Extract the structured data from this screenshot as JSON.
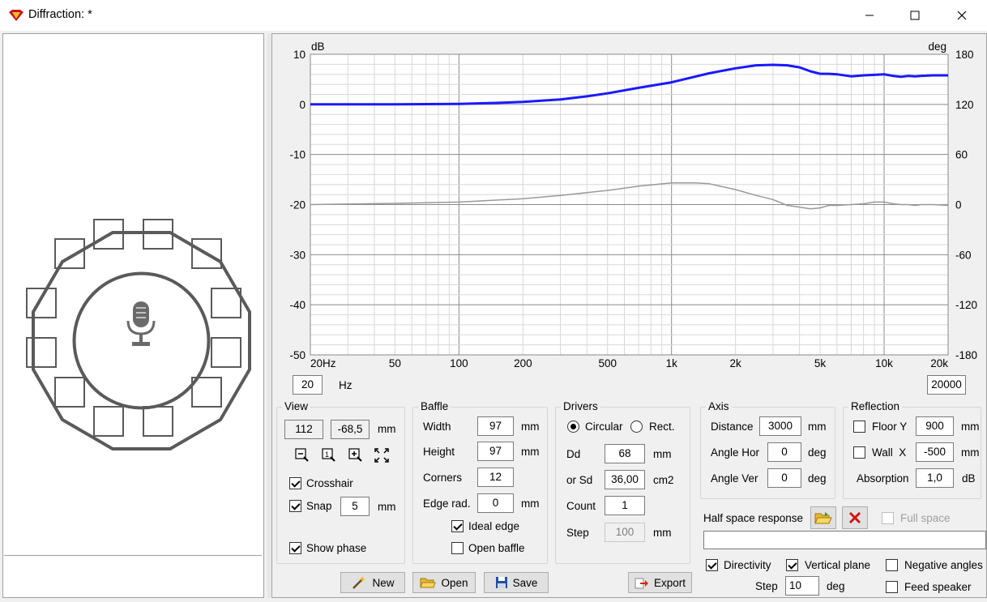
{
  "window": {
    "title": "Diffraction: *"
  },
  "chart_data": {
    "type": "line",
    "xscale": "log",
    "xlim": [
      20,
      20000
    ],
    "ylim": [
      -50,
      10
    ],
    "y2lim": [
      -180,
      180
    ],
    "ylabel": "dB",
    "y2label": "deg",
    "x_ticks": [
      "20Hz",
      "50",
      "100",
      "200",
      "500",
      "1k",
      "2k",
      "5k",
      "10k",
      "20k"
    ],
    "y_ticks": [
      "10",
      "0",
      "-10",
      "-20",
      "-30",
      "-40",
      "-50"
    ],
    "y2_ticks": [
      "180",
      "120",
      "60",
      "0",
      "-60",
      "-120",
      "-180"
    ],
    "grid": true,
    "series": [
      {
        "axis": "left",
        "color": "#1a1aff",
        "x": [
          20,
          50,
          100,
          150,
          200,
          300,
          400,
          500,
          700,
          1000,
          1500,
          2000,
          2500,
          3000,
          3500,
          4000,
          4500,
          5000,
          5500,
          6000,
          7000,
          8000,
          9000,
          10000,
          11000,
          12000,
          13000,
          14000,
          15000,
          17000,
          20000
        ],
        "y": [
          0,
          0,
          0.1,
          0.3,
          0.5,
          1.0,
          1.6,
          2.2,
          3.3,
          4.4,
          6.2,
          7.2,
          7.8,
          7.9,
          7.8,
          7.4,
          6.6,
          6.1,
          6.1,
          6.0,
          5.6,
          5.8,
          5.9,
          6.0,
          5.7,
          5.5,
          5.7,
          5.6,
          5.7,
          5.8,
          5.8
        ]
      },
      {
        "axis": "right",
        "color": "#999999",
        "x": [
          20,
          50,
          100,
          200,
          300,
          500,
          700,
          1000,
          1300,
          1500,
          2000,
          2500,
          3000,
          3500,
          4000,
          4500,
          5000,
          5500,
          6000,
          7000,
          8000,
          9000,
          10000,
          11000,
          12000,
          13000,
          14000,
          15000,
          17000,
          20000
        ],
        "y": [
          0,
          1.5,
          3,
          7,
          11,
          17,
          22,
          26,
          26,
          25,
          18,
          11,
          6,
          -1,
          -3,
          -5,
          -4,
          -1,
          -1,
          0,
          1,
          3,
          3,
          1,
          0,
          0,
          -1,
          0,
          0,
          -1
        ]
      }
    ]
  },
  "freq_min": "20",
  "freq_unit": "Hz",
  "freq_max": "20000",
  "view": {
    "title": "View",
    "x": "112",
    "y": "-68,5",
    "unit": "mm",
    "crosshair": "Crosshair",
    "crosshair_checked": true,
    "snap": "Snap",
    "snap_checked": true,
    "snap_value": "5",
    "snap_unit": "mm",
    "show_phase": "Show phase",
    "show_phase_checked": true
  },
  "baffle": {
    "title": "Baffle",
    "width_label": "Width",
    "width": "97",
    "width_unit": "mm",
    "height_label": "Height",
    "height": "97",
    "height_unit": "mm",
    "corners_label": "Corners",
    "corners": "12",
    "edge_label": "Edge rad.",
    "edge": "0",
    "edge_unit": "mm",
    "ideal_edge": "Ideal edge",
    "ideal_edge_checked": true,
    "open_baffle": "Open baffle",
    "open_baffle_checked": false
  },
  "drivers": {
    "title": "Drivers",
    "circular": "Circular",
    "rect": "Rect.",
    "dd_label": "Dd",
    "dd": "68",
    "dd_unit": "mm",
    "sd_label": "or Sd",
    "sd": "36,00",
    "sd_unit": "cm2",
    "count_label": "Count",
    "count": "1",
    "step_label": "Step",
    "step": "100",
    "step_unit": "mm"
  },
  "axis": {
    "title": "Axis",
    "distance_label": "Distance",
    "distance": "3000",
    "distance_unit": "mm",
    "angle_hor_label": "Angle Hor",
    "angle_hor": "0",
    "angle_hor_unit": "deg",
    "angle_ver_label": "Angle Ver",
    "angle_ver": "0",
    "angle_ver_unit": "deg"
  },
  "reflection": {
    "title": "Reflection",
    "floor_label": "Floor Y",
    "floor": "900",
    "floor_unit": "mm",
    "wall_label": "Wall  X",
    "wall": "-500",
    "wall_unit": "mm",
    "absorption_label": "Absorption",
    "absorption": "1,0",
    "absorption_unit": "dB"
  },
  "half_space": {
    "label": "Half space response",
    "full_space": "Full space"
  },
  "directivity": {
    "directivity": "Directivity",
    "vertical_plane": "Vertical plane",
    "negative_angles": "Negative angles",
    "feed_speaker": "Feed speaker",
    "step_label": "Step",
    "step": "10",
    "step_unit": "deg"
  },
  "buttons": {
    "new": "New",
    "open": "Open",
    "save": "Save",
    "export": "Export"
  }
}
